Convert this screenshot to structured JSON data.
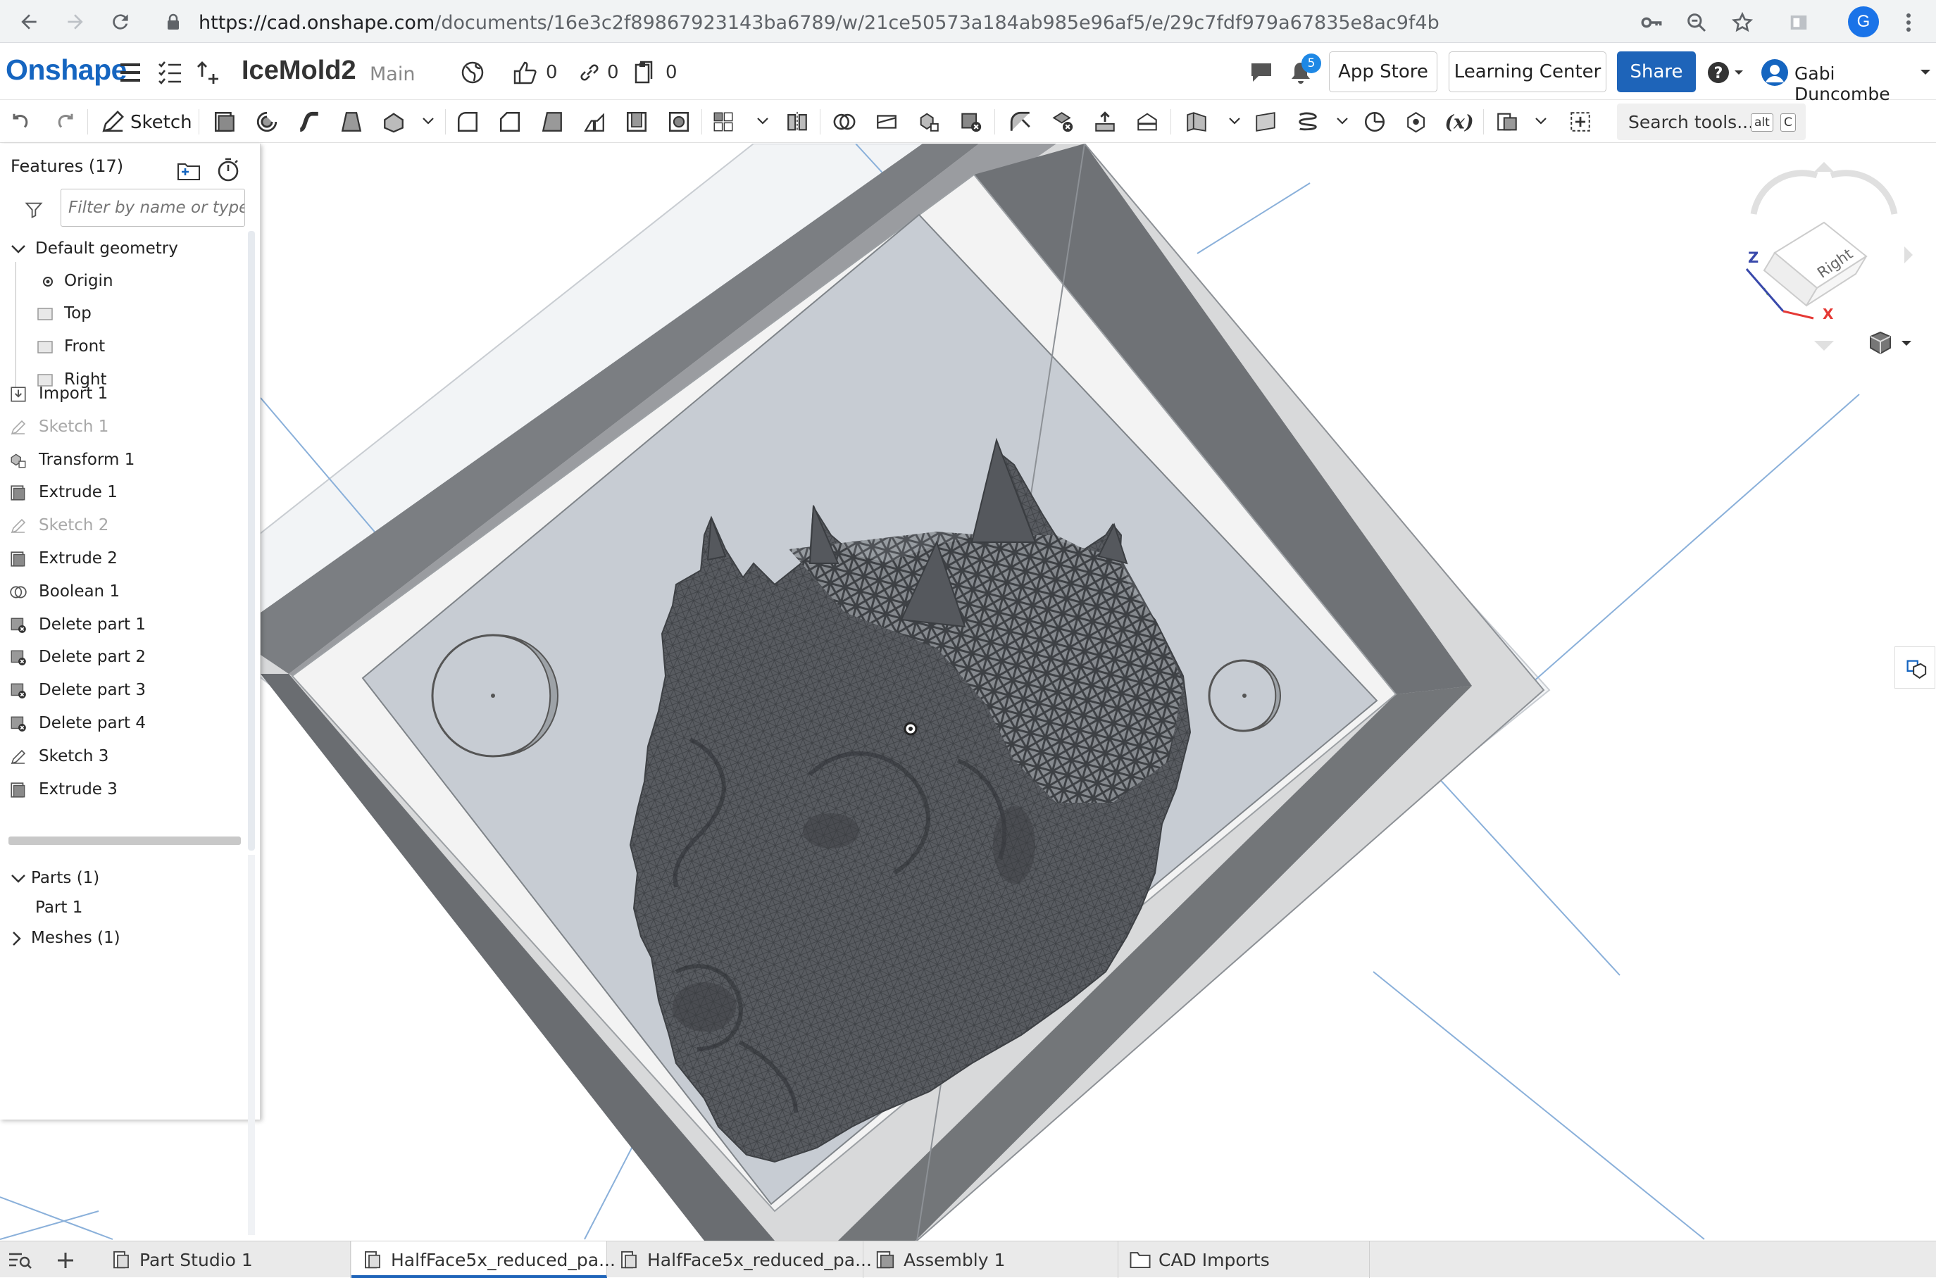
{
  "browser": {
    "url_host": "https://cad.onshape.com",
    "url_path": "/documents/16e3c2f89867923143ba6789/w/21ce50573a184ab985e96af5/e/29c7fdf979a67835e8ac9f4b",
    "profile_initial": "G"
  },
  "header": {
    "logo": "Onshape",
    "document_name": "IceMold2",
    "workspace": "Main",
    "likes": "0",
    "links": "0",
    "copies": "0",
    "notifications": "5",
    "app_store": "App Store",
    "learning_center": "Learning Center",
    "share": "Share",
    "user": "Gabi Duncombe"
  },
  "toolbar": {
    "sketch_label": "Sketch",
    "search_label": "Search tools...",
    "shortcut_key1": "alt",
    "shortcut_key2": "C"
  },
  "features": {
    "title": "Features (17)",
    "filter_placeholder": "Filter by name or type",
    "default_geometry": "Default geometry",
    "origin": "Origin",
    "planes": [
      "Top",
      "Front",
      "Right"
    ],
    "items": [
      {
        "label": "Import 1",
        "icon": "import-icon",
        "suppressed": false
      },
      {
        "label": "Sketch 1",
        "icon": "sketch-icon",
        "suppressed": true
      },
      {
        "label": "Transform 1",
        "icon": "transform-icon",
        "suppressed": false
      },
      {
        "label": "Extrude 1",
        "icon": "extrude-icon",
        "suppressed": false
      },
      {
        "label": "Sketch 2",
        "icon": "sketch-icon",
        "suppressed": true
      },
      {
        "label": "Extrude 2",
        "icon": "extrude-icon",
        "suppressed": false
      },
      {
        "label": "Boolean 1",
        "icon": "boolean-icon",
        "suppressed": false
      },
      {
        "label": "Delete part 1",
        "icon": "delete-part-icon",
        "suppressed": false
      },
      {
        "label": "Delete part 2",
        "icon": "delete-part-icon",
        "suppressed": false
      },
      {
        "label": "Delete part 3",
        "icon": "delete-part-icon",
        "suppressed": false
      },
      {
        "label": "Delete part 4",
        "icon": "delete-part-icon",
        "suppressed": false
      },
      {
        "label": "Sketch 3",
        "icon": "sketch-icon",
        "suppressed": false
      },
      {
        "label": "Extrude 3",
        "icon": "extrude-icon",
        "suppressed": false
      }
    ],
    "parts_header": "Parts (1)",
    "part1": "Part 1",
    "meshes_header": "Meshes (1)"
  },
  "viewcube": {
    "face_label": "Right",
    "axis_z": "Z",
    "axis_x": "X"
  },
  "tabs": [
    {
      "label": "Part Studio 1",
      "icon": "part-studio-icon",
      "active": false
    },
    {
      "label": "HalfFace5x_reduced_pa...",
      "icon": "part-studio-icon",
      "active": true
    },
    {
      "label": "HalfFace5x_reduced_pa...",
      "icon": "part-studio-icon",
      "active": false
    },
    {
      "label": "Assembly 1",
      "icon": "assembly-icon",
      "active": false
    },
    {
      "label": "CAD Imports",
      "icon": "folder-icon",
      "active": false
    }
  ],
  "colors": {
    "brand_blue": "#1565c0",
    "share_blue": "#1e64b9",
    "mesh_gray": "#5a5d62",
    "plane_blue": "#b3cde8"
  }
}
